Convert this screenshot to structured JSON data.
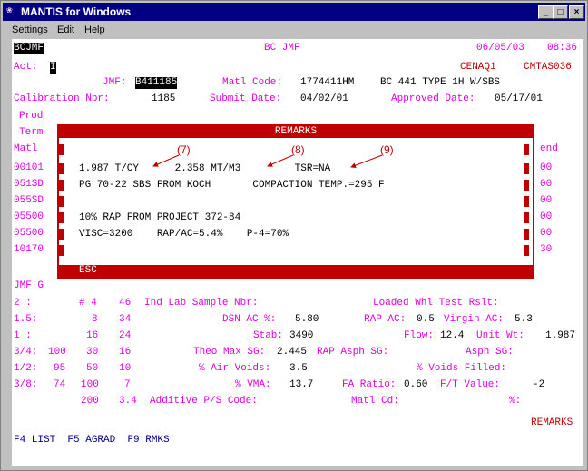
{
  "window": {
    "title": "MANTIS for Windows"
  },
  "menu": [
    "Settings",
    "Edit",
    "Help"
  ],
  "header": {
    "screen_id": "BCJMF",
    "screen_name": "BC JMF",
    "date": "06/05/03",
    "time": "08:36",
    "act_label": "Act:",
    "act_value": "I",
    "user1": "CENAQ1",
    "user2": "CMTAS036"
  },
  "jmf_line": {
    "jmf_label": "JMF:",
    "jmf_value": "B411185",
    "matl_code_label": "Matl Code:",
    "matl_code_value": "1774411HM",
    "matl_desc": "BC 441 TYPE 1H W/SBS"
  },
  "calib_line": {
    "calib_label": "Calibration Nbr:",
    "calib_value": "1185",
    "submit_label": "Submit Date:",
    "submit_value": "04/02/01",
    "approved_label": "Approved Date:",
    "approved_value": "05/17/01"
  },
  "left_col": {
    "prod": "Prod",
    "term": "Term",
    "matl": "Matl",
    "items": [
      "00101",
      "051SD",
      "055SD",
      "05500",
      "05500",
      "10170"
    ]
  },
  "right_col": {
    "end": "end",
    "items": [
      "00",
      "00",
      "00",
      "00",
      "00",
      "30"
    ]
  },
  "remarks": {
    "title": "REMARKS",
    "lines": [
      "1.987 T/CY      2.358 MT/M3         TSR=NA",
      "PG 70-22 SBS FROM KOCH       COMPACTION TEMP.=295 F",
      "",
      "10% RAP FROM PROJECT 372-84",
      "VISC=3200    RAP/AC=5.4%    P-4=70%"
    ],
    "escape": "ESC"
  },
  "annotations": [
    "(7)",
    "(8)",
    "(9)"
  ],
  "jmf_g": "JMF G",
  "sieves": {
    "rows": [
      {
        "sieve": "2 :",
        "c1": "# 4",
        "c2": "46"
      },
      {
        "sieve": "1.5:",
        "c1": "8",
        "c2": "34"
      },
      {
        "sieve": "1 :",
        "c1": "16",
        "c2": "24"
      },
      {
        "sieve": "3/4:",
        "c0": "100",
        "c1": "30",
        "c2": "16"
      },
      {
        "sieve": "1/2:",
        "c0": "95",
        "c1": "50",
        "c2": "10"
      },
      {
        "sieve": "3/8:",
        "c0": "74",
        "c1": "100",
        "c2": "7"
      },
      {
        "sieve": "",
        "c1": "200",
        "c2": "3.4"
      }
    ]
  },
  "props": {
    "ind_lab_label": "Ind Lab Sample Nbr:",
    "loaded_label": "Loaded Whl Test Rslt:",
    "dsn_ac_label": "DSN AC %:",
    "dsn_ac_value": "5.80",
    "rap_ac_label": "RAP AC:",
    "rap_ac_value": "0.5",
    "virgin_ac_label": "Virgin AC:",
    "virgin_ac_value": "5.3",
    "stab_label": "Stab:",
    "stab_value": "3490",
    "flow_label": "Flow:",
    "flow_value": "12.4",
    "unit_wt_label": "Unit Wt:",
    "unit_wt_value": "1.987",
    "theo_label": "Theo Max SG:",
    "theo_value": "2.445",
    "rap_asph_label": "RAP Asph SG:",
    "asph_label": "Asph SG:",
    "air_voids_label": "% Air Voids:",
    "air_voids_value": "3.5",
    "voids_filled_label": "% Voids Filled:",
    "vma_label": "% VMA:",
    "vma_value": "13.7",
    "fa_ratio_label": "FA Ratio:",
    "fa_ratio_value": "0.60",
    "ft_label": "F/T Value:",
    "ft_value": "-2",
    "additive_label": "Additive P/S Code:",
    "matl_cd_label": "Matl Cd:",
    "pct_label": "%:",
    "remarks_flag": "REMARKS"
  },
  "function_keys": "F4 LIST  F5 AGRAD  F9 RMKS"
}
